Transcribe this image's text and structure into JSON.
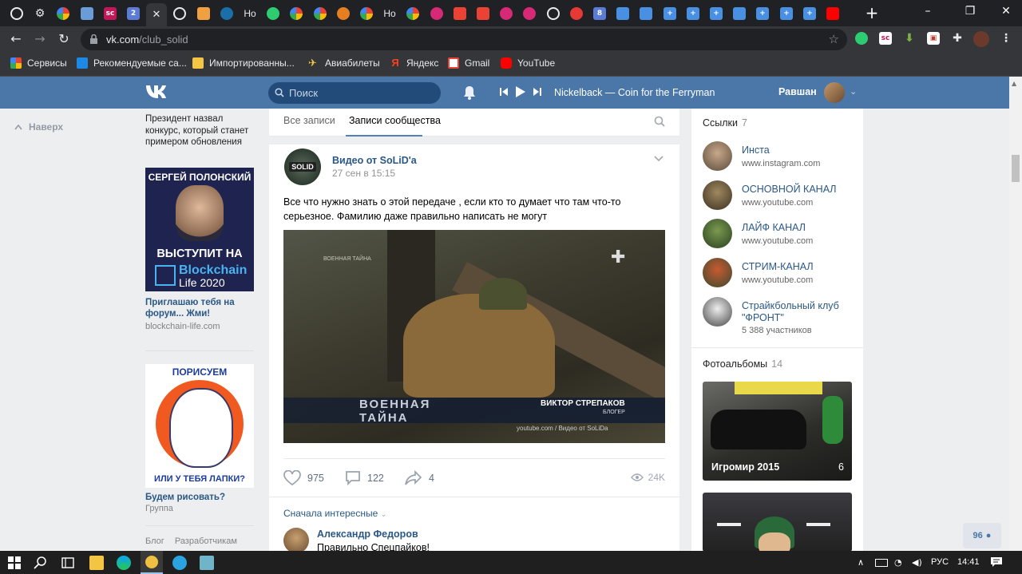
{
  "browser": {
    "tab_bar": {
      "tabs": [
        {
          "icon": "globe-icon",
          "color": "#e8eaed"
        },
        {
          "icon": "gear-icon",
          "color": "#e8eaed"
        },
        {
          "icon": "google-icon",
          "color": "#ffffff"
        },
        {
          "icon": "user-icon",
          "color": "#6a9cd8"
        },
        {
          "icon": "sc-icon",
          "color": "#c2185b"
        },
        {
          "icon": "number-2-icon",
          "color": "#5b7bd5"
        },
        {
          "icon": "close-icon",
          "color": "#e8eaed",
          "active": true
        },
        {
          "icon": "globe-icon",
          "color": "#e8eaed"
        },
        {
          "icon": "calendar-icon",
          "color": "#f0a040"
        },
        {
          "icon": "steam-icon",
          "color": "#1b6fa8"
        },
        {
          "icon": "text-icon",
          "color": "#e8eaed",
          "label": "Ho"
        },
        {
          "icon": "check-icon",
          "color": "#2ecc71"
        },
        {
          "icon": "google-icon",
          "color": "#ffffff"
        },
        {
          "icon": "google-icon",
          "color": "#ffffff"
        },
        {
          "icon": "flower-icon",
          "color": "#e67e22"
        },
        {
          "icon": "google-icon",
          "color": "#ffffff"
        },
        {
          "icon": "text-icon",
          "color": "#e8eaed",
          "label": "Ho"
        },
        {
          "icon": "google-icon",
          "color": "#ffffff"
        },
        {
          "icon": "instagram-icon",
          "color": "#d62976"
        },
        {
          "icon": "gmail-icon",
          "color": "#ea4335"
        },
        {
          "icon": "gmail-icon",
          "color": "#ea4335"
        },
        {
          "icon": "instagram-icon",
          "color": "#d62976"
        },
        {
          "icon": "instagram-icon",
          "color": "#d62976"
        },
        {
          "icon": "globe-icon",
          "color": "#e8eaed"
        },
        {
          "icon": "app-icon",
          "color": "#e53935"
        },
        {
          "icon": "number-8-icon",
          "color": "#5b7bd5"
        },
        {
          "icon": "chat-icon",
          "color": "#4a90e2"
        },
        {
          "icon": "chat-icon",
          "color": "#4a90e2"
        },
        {
          "icon": "plus-box-icon",
          "color": "#4a90e2"
        },
        {
          "icon": "plus-box-icon",
          "color": "#4a90e2"
        },
        {
          "icon": "plus-box-icon",
          "color": "#4a90e2"
        },
        {
          "icon": "chat-icon",
          "color": "#4a90e2"
        },
        {
          "icon": "plus-box-icon",
          "color": "#4a90e2"
        },
        {
          "icon": "plus-box-icon",
          "color": "#4a90e2"
        },
        {
          "icon": "plus-box-icon",
          "color": "#4a90e2"
        },
        {
          "icon": "youtube-icon",
          "color": "#ff0000"
        }
      ]
    },
    "address": {
      "host": "vk.com",
      "path": "/club_solid"
    },
    "bookmarks": [
      {
        "label": "Сервисы",
        "color": "#4285f4"
      },
      {
        "label": "Рекомендуемые са...",
        "color": "#1e88e5"
      },
      {
        "label": "Импортированны...",
        "color": "#f4c542"
      },
      {
        "label": "Авиабилеты",
        "color": "#f4c542"
      },
      {
        "label": "Яндекс",
        "color": "#fc3f1d"
      },
      {
        "label": "Gmail",
        "color": "#ea4335"
      },
      {
        "label": "YouTube",
        "color": "#ff0000"
      }
    ]
  },
  "vk": {
    "header": {
      "search_placeholder": "Поиск",
      "track": "Nickelback — Coin for the Ferryman",
      "user_name": "Равшан"
    },
    "left": {
      "up_label": "Наверх",
      "news_text": "Президент назвал конкурс, который станет примером обновления",
      "ad1": {
        "name": "СЕРГЕЙ ПОЛОНСКИЙ",
        "speak": "ВЫСТУПИТ НА",
        "brand1": "Blockchain",
        "brand2": "Life 2020",
        "link": "Приглашаю тебя на форум... Жми!",
        "domain": "blockchain-life.com"
      },
      "ad2": {
        "top": "ПОРИСУЕМ",
        "bottom": "ИЛИ У ТЕБЯ ЛАПКИ?",
        "link": "Будем рисовать?",
        "type": "Группа"
      },
      "footer": [
        "Блог",
        "Разработчикам"
      ]
    },
    "wall": {
      "tab_all": "Все записи",
      "tab_community": "Записи сообщества",
      "post": {
        "avatar_text": "SOLID",
        "author": "Видео от SoLiD'a",
        "date": "27 сен в 15:15",
        "text": "Все что нужно знать о этой передаче , если кто то думает что там что-то серьезное. Фамилию даже правильно написать не могут",
        "video": {
          "tag": "ВОЕННАЯ ТАЙНА",
          "title1": "ВОЕННАЯ",
          "title2": "ТАЙНА",
          "name": "ВИКТОР СТРЕПАКОВ",
          "role": "БЛОГЕР",
          "source": "youtube.com / Видео от SoLiDa"
        },
        "likes": "975",
        "comments": "122",
        "shares": "4",
        "views": "24K"
      },
      "sort_label": "Сначала интересные",
      "comment": {
        "author": "Александр Федоров",
        "text": "Правильно Спецпайков!"
      }
    },
    "right": {
      "links_title": "Ссылки",
      "links_count": "7",
      "links": [
        {
          "title": "Инста",
          "sub": "www.instagram.com"
        },
        {
          "title": "ОСНОВНОЙ КАНАЛ",
          "sub": "www.youtube.com"
        },
        {
          "title": "ЛАЙФ КАНАЛ",
          "sub": "www.youtube.com"
        },
        {
          "title": "СТРИМ-КАНАЛ",
          "sub": "www.youtube.com"
        },
        {
          "title": "Страйкбольный клуб \"ФРОНТ\"",
          "sub": "5 388 участников"
        }
      ],
      "albums_title": "Фотоальбомы",
      "albums_count": "14",
      "albums": [
        {
          "label": "Игромир 2015",
          "count": "6"
        }
      ]
    },
    "online_count": "96"
  },
  "taskbar": {
    "lang": "РУС",
    "time": "14:41"
  }
}
